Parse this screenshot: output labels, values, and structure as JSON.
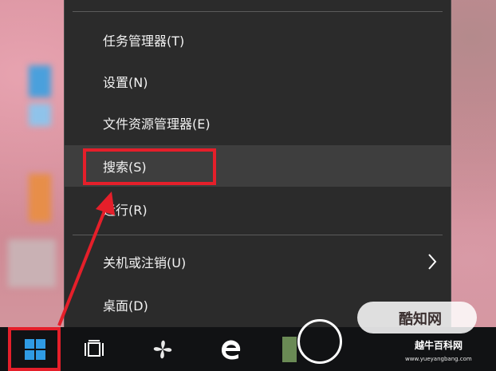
{
  "context_menu": {
    "items": [
      {
        "label": "任务管理器(T)"
      },
      {
        "label": "设置(N)"
      },
      {
        "label": "文件资源管理器(E)"
      },
      {
        "label": "搜索(S)"
      },
      {
        "label": "运行(R)"
      },
      {
        "label": "关机或注销(U)"
      },
      {
        "label": "桌面(D)"
      }
    ]
  },
  "watermark": {
    "brand": "酷知网",
    "brand2": "越牛百科网",
    "url": "www.yueyangbang.com"
  },
  "colors": {
    "menu_bg": "#2b2b2b",
    "highlight": "#3e3e3e",
    "annotation_red": "#e51f2a",
    "taskbar": "#111214",
    "start_blue": "#2f9be4"
  },
  "icons": [
    "windows-start-icon",
    "task-view-icon",
    "pinwheel-app-icon",
    "edge-icon",
    "chevron-right-icon"
  ]
}
